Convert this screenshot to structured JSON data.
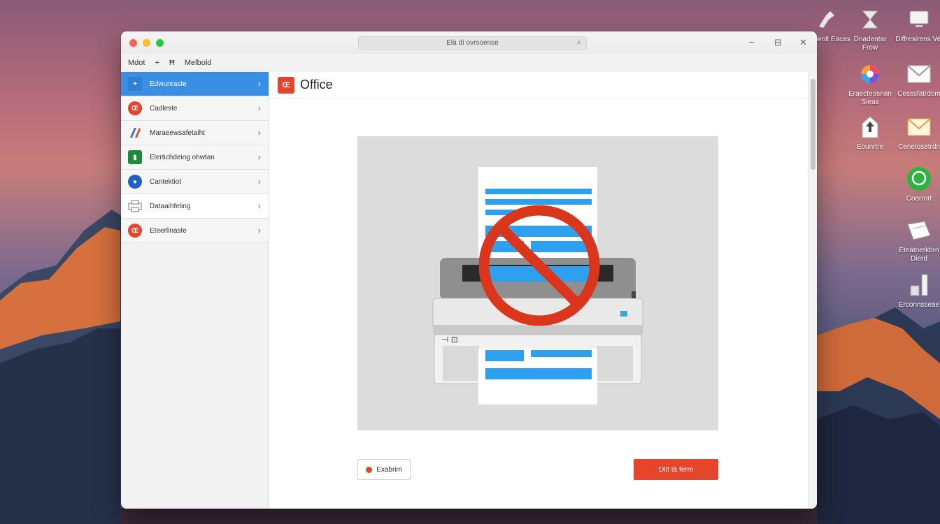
{
  "window": {
    "address": "Elà dì ovrsoense",
    "controls": {
      "minimize": "−",
      "restore": "⊟",
      "close": "✕"
    }
  },
  "menubar": {
    "items": [
      "Mdot",
      "+",
      "Ħ",
      "Melbold"
    ]
  },
  "sidebar": {
    "items": [
      {
        "label": "Edwunraste",
        "icon": "plus-icon",
        "color": "#3a8ee6"
      },
      {
        "label": "Cadleste",
        "icon": "office-icon",
        "color": "#e4452b"
      },
      {
        "label": "Maraeewsafetaiht",
        "icon": "pencil-icon",
        "color": "#2f6fd6"
      },
      {
        "label": "Elertichdeing ohwtan",
        "icon": "excel-icon",
        "color": "#1e8b3b"
      },
      {
        "label": "Cantektiot",
        "icon": "outlook-icon",
        "color": "#2160c4"
      },
      {
        "label": "Dataaihfeling",
        "icon": "printer-icon",
        "color": "#888888"
      },
      {
        "label": "Eteerlinaste",
        "icon": "office-icon",
        "color": "#e4452b"
      }
    ]
  },
  "main": {
    "logo_text": "Œ",
    "title": "Office",
    "btn_left": "Exabrim",
    "btn_right": "Ditt tà ferm"
  },
  "desktop": {
    "icons": [
      {
        "label": "Dantwolt Eacas",
        "icon": "telescope-icon"
      },
      {
        "label": "Dnadentar Frow",
        "icon": "hourglass-icon"
      },
      {
        "label": "Diffresirens Vet",
        "icon": "monitor-icon"
      },
      {
        "label": "Eraecteosnan Sieas",
        "icon": "color-wheel-icon"
      },
      {
        "label": "Cesssfatrdom",
        "icon": "mail-icon"
      },
      {
        "label": "Eounrtre",
        "icon": "arrow-up-icon"
      },
      {
        "label": "Cenetosetrdn",
        "icon": "mail-icon"
      },
      {
        "label": "Coorrort",
        "icon": "chat-icon"
      },
      {
        "label": "Eteatnerkbrn Dierd",
        "icon": "notebook-icon"
      },
      {
        "label": "Erconnsseae",
        "icon": "music-icon"
      }
    ]
  },
  "colors": {
    "accent": "#3a8ee6",
    "office_red": "#e4452b",
    "prohibit_red": "#d9361d",
    "doc_blue": "#2ea0f0"
  }
}
